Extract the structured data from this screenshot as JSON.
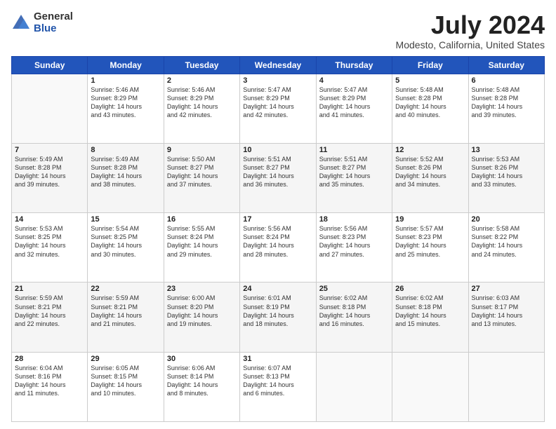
{
  "logo": {
    "general": "General",
    "blue": "Blue"
  },
  "title": "July 2024",
  "subtitle": "Modesto, California, United States",
  "weekdays": [
    "Sunday",
    "Monday",
    "Tuesday",
    "Wednesday",
    "Thursday",
    "Friday",
    "Saturday"
  ],
  "weeks": [
    [
      {
        "day": "",
        "info": ""
      },
      {
        "day": "1",
        "info": "Sunrise: 5:46 AM\nSunset: 8:29 PM\nDaylight: 14 hours\nand 43 minutes."
      },
      {
        "day": "2",
        "info": "Sunrise: 5:46 AM\nSunset: 8:29 PM\nDaylight: 14 hours\nand 42 minutes."
      },
      {
        "day": "3",
        "info": "Sunrise: 5:47 AM\nSunset: 8:29 PM\nDaylight: 14 hours\nand 42 minutes."
      },
      {
        "day": "4",
        "info": "Sunrise: 5:47 AM\nSunset: 8:29 PM\nDaylight: 14 hours\nand 41 minutes."
      },
      {
        "day": "5",
        "info": "Sunrise: 5:48 AM\nSunset: 8:28 PM\nDaylight: 14 hours\nand 40 minutes."
      },
      {
        "day": "6",
        "info": "Sunrise: 5:48 AM\nSunset: 8:28 PM\nDaylight: 14 hours\nand 39 minutes."
      }
    ],
    [
      {
        "day": "7",
        "info": "Sunrise: 5:49 AM\nSunset: 8:28 PM\nDaylight: 14 hours\nand 39 minutes."
      },
      {
        "day": "8",
        "info": "Sunrise: 5:49 AM\nSunset: 8:28 PM\nDaylight: 14 hours\nand 38 minutes."
      },
      {
        "day": "9",
        "info": "Sunrise: 5:50 AM\nSunset: 8:27 PM\nDaylight: 14 hours\nand 37 minutes."
      },
      {
        "day": "10",
        "info": "Sunrise: 5:51 AM\nSunset: 8:27 PM\nDaylight: 14 hours\nand 36 minutes."
      },
      {
        "day": "11",
        "info": "Sunrise: 5:51 AM\nSunset: 8:27 PM\nDaylight: 14 hours\nand 35 minutes."
      },
      {
        "day": "12",
        "info": "Sunrise: 5:52 AM\nSunset: 8:26 PM\nDaylight: 14 hours\nand 34 minutes."
      },
      {
        "day": "13",
        "info": "Sunrise: 5:53 AM\nSunset: 8:26 PM\nDaylight: 14 hours\nand 33 minutes."
      }
    ],
    [
      {
        "day": "14",
        "info": "Sunrise: 5:53 AM\nSunset: 8:25 PM\nDaylight: 14 hours\nand 32 minutes."
      },
      {
        "day": "15",
        "info": "Sunrise: 5:54 AM\nSunset: 8:25 PM\nDaylight: 14 hours\nand 30 minutes."
      },
      {
        "day": "16",
        "info": "Sunrise: 5:55 AM\nSunset: 8:24 PM\nDaylight: 14 hours\nand 29 minutes."
      },
      {
        "day": "17",
        "info": "Sunrise: 5:56 AM\nSunset: 8:24 PM\nDaylight: 14 hours\nand 28 minutes."
      },
      {
        "day": "18",
        "info": "Sunrise: 5:56 AM\nSunset: 8:23 PM\nDaylight: 14 hours\nand 27 minutes."
      },
      {
        "day": "19",
        "info": "Sunrise: 5:57 AM\nSunset: 8:23 PM\nDaylight: 14 hours\nand 25 minutes."
      },
      {
        "day": "20",
        "info": "Sunrise: 5:58 AM\nSunset: 8:22 PM\nDaylight: 14 hours\nand 24 minutes."
      }
    ],
    [
      {
        "day": "21",
        "info": "Sunrise: 5:59 AM\nSunset: 8:21 PM\nDaylight: 14 hours\nand 22 minutes."
      },
      {
        "day": "22",
        "info": "Sunrise: 5:59 AM\nSunset: 8:21 PM\nDaylight: 14 hours\nand 21 minutes."
      },
      {
        "day": "23",
        "info": "Sunrise: 6:00 AM\nSunset: 8:20 PM\nDaylight: 14 hours\nand 19 minutes."
      },
      {
        "day": "24",
        "info": "Sunrise: 6:01 AM\nSunset: 8:19 PM\nDaylight: 14 hours\nand 18 minutes."
      },
      {
        "day": "25",
        "info": "Sunrise: 6:02 AM\nSunset: 8:18 PM\nDaylight: 14 hours\nand 16 minutes."
      },
      {
        "day": "26",
        "info": "Sunrise: 6:02 AM\nSunset: 8:18 PM\nDaylight: 14 hours\nand 15 minutes."
      },
      {
        "day": "27",
        "info": "Sunrise: 6:03 AM\nSunset: 8:17 PM\nDaylight: 14 hours\nand 13 minutes."
      }
    ],
    [
      {
        "day": "28",
        "info": "Sunrise: 6:04 AM\nSunset: 8:16 PM\nDaylight: 14 hours\nand 11 minutes."
      },
      {
        "day": "29",
        "info": "Sunrise: 6:05 AM\nSunset: 8:15 PM\nDaylight: 14 hours\nand 10 minutes."
      },
      {
        "day": "30",
        "info": "Sunrise: 6:06 AM\nSunset: 8:14 PM\nDaylight: 14 hours\nand 8 minutes."
      },
      {
        "day": "31",
        "info": "Sunrise: 6:07 AM\nSunset: 8:13 PM\nDaylight: 14 hours\nand 6 minutes."
      },
      {
        "day": "",
        "info": ""
      },
      {
        "day": "",
        "info": ""
      },
      {
        "day": "",
        "info": ""
      }
    ]
  ]
}
